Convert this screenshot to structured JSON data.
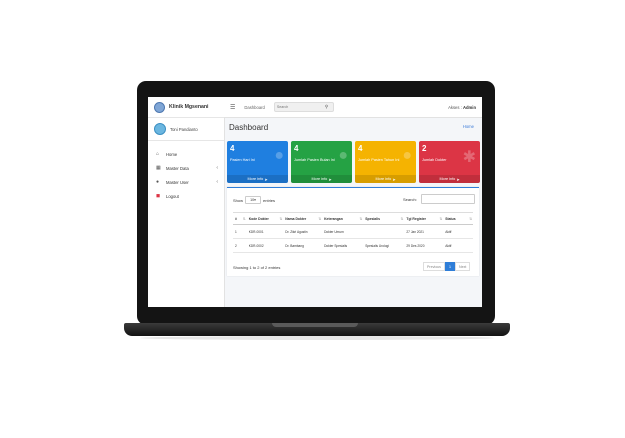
{
  "sidebar": {
    "brand": "Klinik Mgsenani",
    "user_name": "Toni Pandianto",
    "items": [
      {
        "label": "Home",
        "icon": "home-icon",
        "has_arrow": false
      },
      {
        "label": "Master Data",
        "icon": "book-icon",
        "has_arrow": true
      },
      {
        "label": "Master User",
        "icon": "users-icon",
        "has_arrow": true
      },
      {
        "label": "Logout",
        "icon": "logout-icon",
        "has_arrow": false
      }
    ]
  },
  "topbar": {
    "dashboard_link": "Dashboard",
    "search_placeholder": "Search",
    "user_prefix": "Akses :",
    "user_role": "Admin"
  },
  "header": {
    "title": "Dashboard",
    "breadcrumb": "Home"
  },
  "stat_boxes": [
    {
      "number": "4",
      "label": "Pasien Hari Ini",
      "footer": "More info",
      "color": "#1f7fe0"
    },
    {
      "number": "4",
      "label": "Jumlah Pasien Bulan Ini",
      "footer": "More info",
      "color": "#25a244"
    },
    {
      "number": "4",
      "label": "Jumlah Pasien Tahun Ini",
      "footer": "More info",
      "color": "#f5b301"
    },
    {
      "number": "2",
      "label": "Jumlah Dokter",
      "footer": "More info",
      "color": "#dc3545"
    }
  ],
  "table": {
    "show_label": "Show",
    "entries_value": "10",
    "entries_label": "entries",
    "search_label": "Search:",
    "columns": [
      "#",
      "Kode Dokter",
      "Nama Dokter",
      "Keterangan",
      "Spesialis",
      "Tgl Register",
      "Status"
    ],
    "rows": [
      [
        "1",
        "KDR-0001",
        "Dr. Zikri Agustin",
        "Dokter Umum",
        "",
        "27 Jan 2021",
        "Aktif"
      ],
      [
        "2",
        "KDR-0002",
        "Dr. Bambang",
        "Dokter Spesialis",
        "Spesialis Urologi",
        "29 Des 2020",
        "Aktif"
      ]
    ],
    "showing_text": "Showing 1 to 2 of 2 entries",
    "pagination": {
      "previous": "Previous",
      "current": "1",
      "next": "Next"
    }
  }
}
